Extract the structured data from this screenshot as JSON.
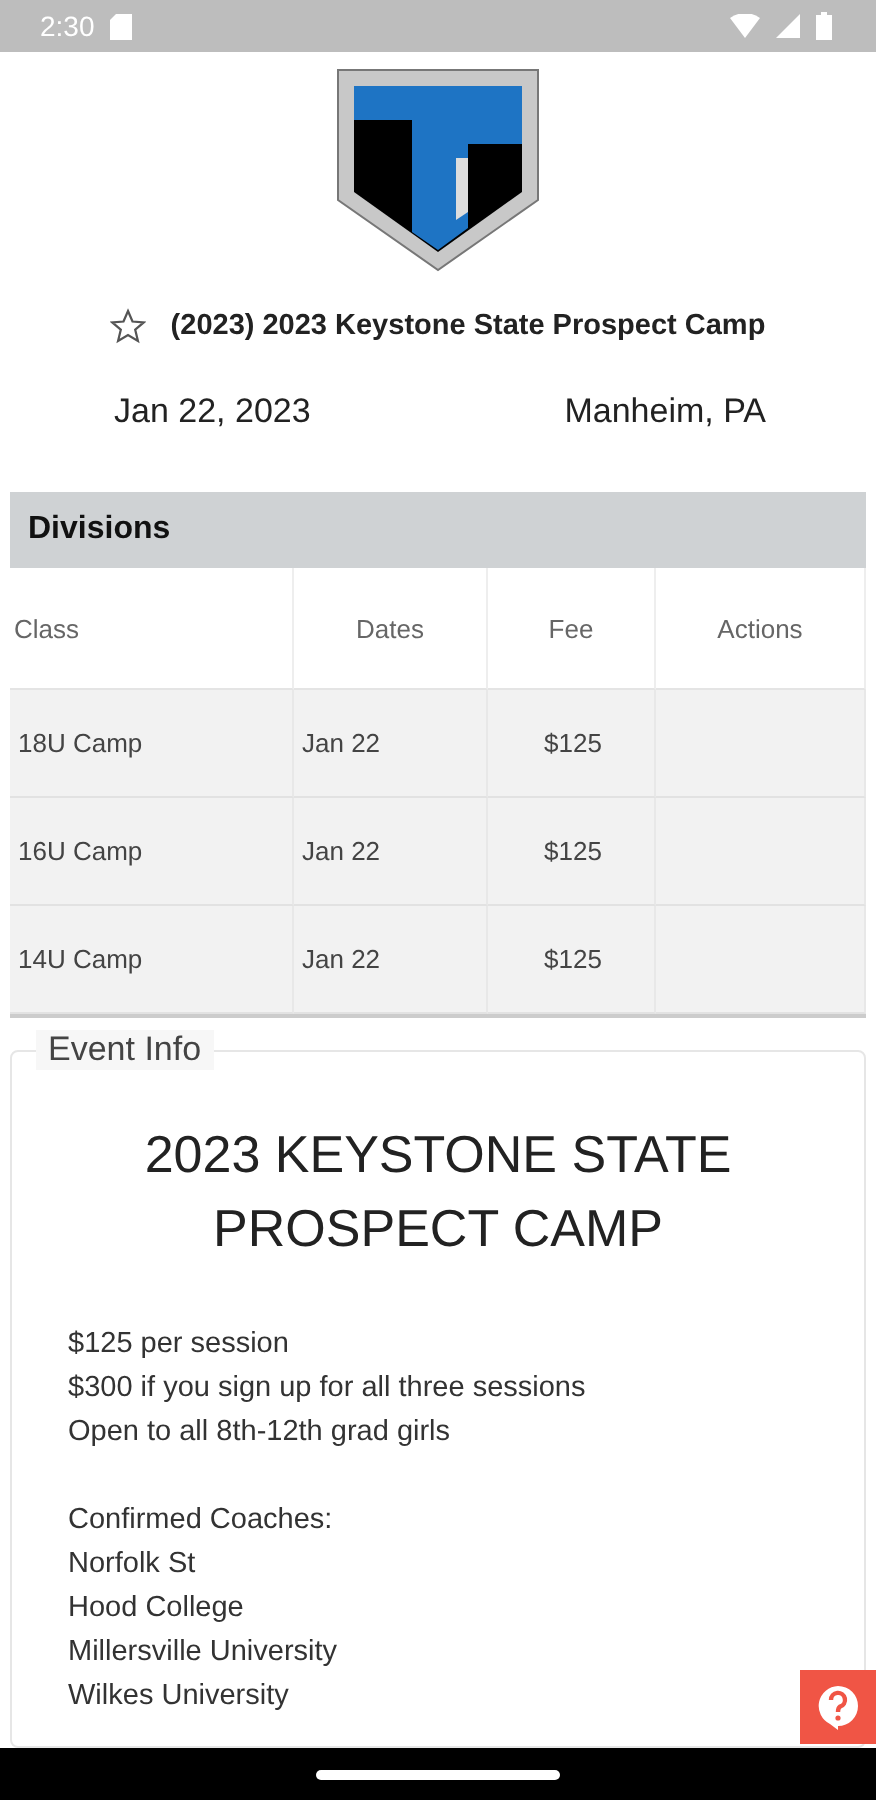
{
  "status_bar": {
    "time": "2:30"
  },
  "event": {
    "favorite": false,
    "title": "(2023) 2023 Keystone State Prospect Camp",
    "date": "Jan 22, 2023",
    "location": "Manheim, PA"
  },
  "divisions": {
    "title": "Divisions",
    "columns": [
      "Class",
      "Dates",
      "Fee",
      "Actions"
    ],
    "rows": [
      [
        "18U Camp",
        "Jan 22",
        "$125",
        ""
      ],
      [
        "16U Camp",
        "Jan 22",
        "$125",
        ""
      ],
      [
        "14U Camp",
        "Jan 22",
        "$125",
        ""
      ]
    ]
  },
  "event_info": {
    "legend": "Event Info",
    "heading": "2023 KEYSTONE STATE PROSPECT CAMP",
    "paragraphs": [
      [
        "$125 per session",
        "$300 if you sign up for all three sessions",
        "Open to all 8th-12th grad girls"
      ],
      [
        "Confirmed Coaches:",
        "Norfolk St",
        "Hood College",
        "Millersville University",
        "Wilkes University"
      ]
    ]
  }
}
